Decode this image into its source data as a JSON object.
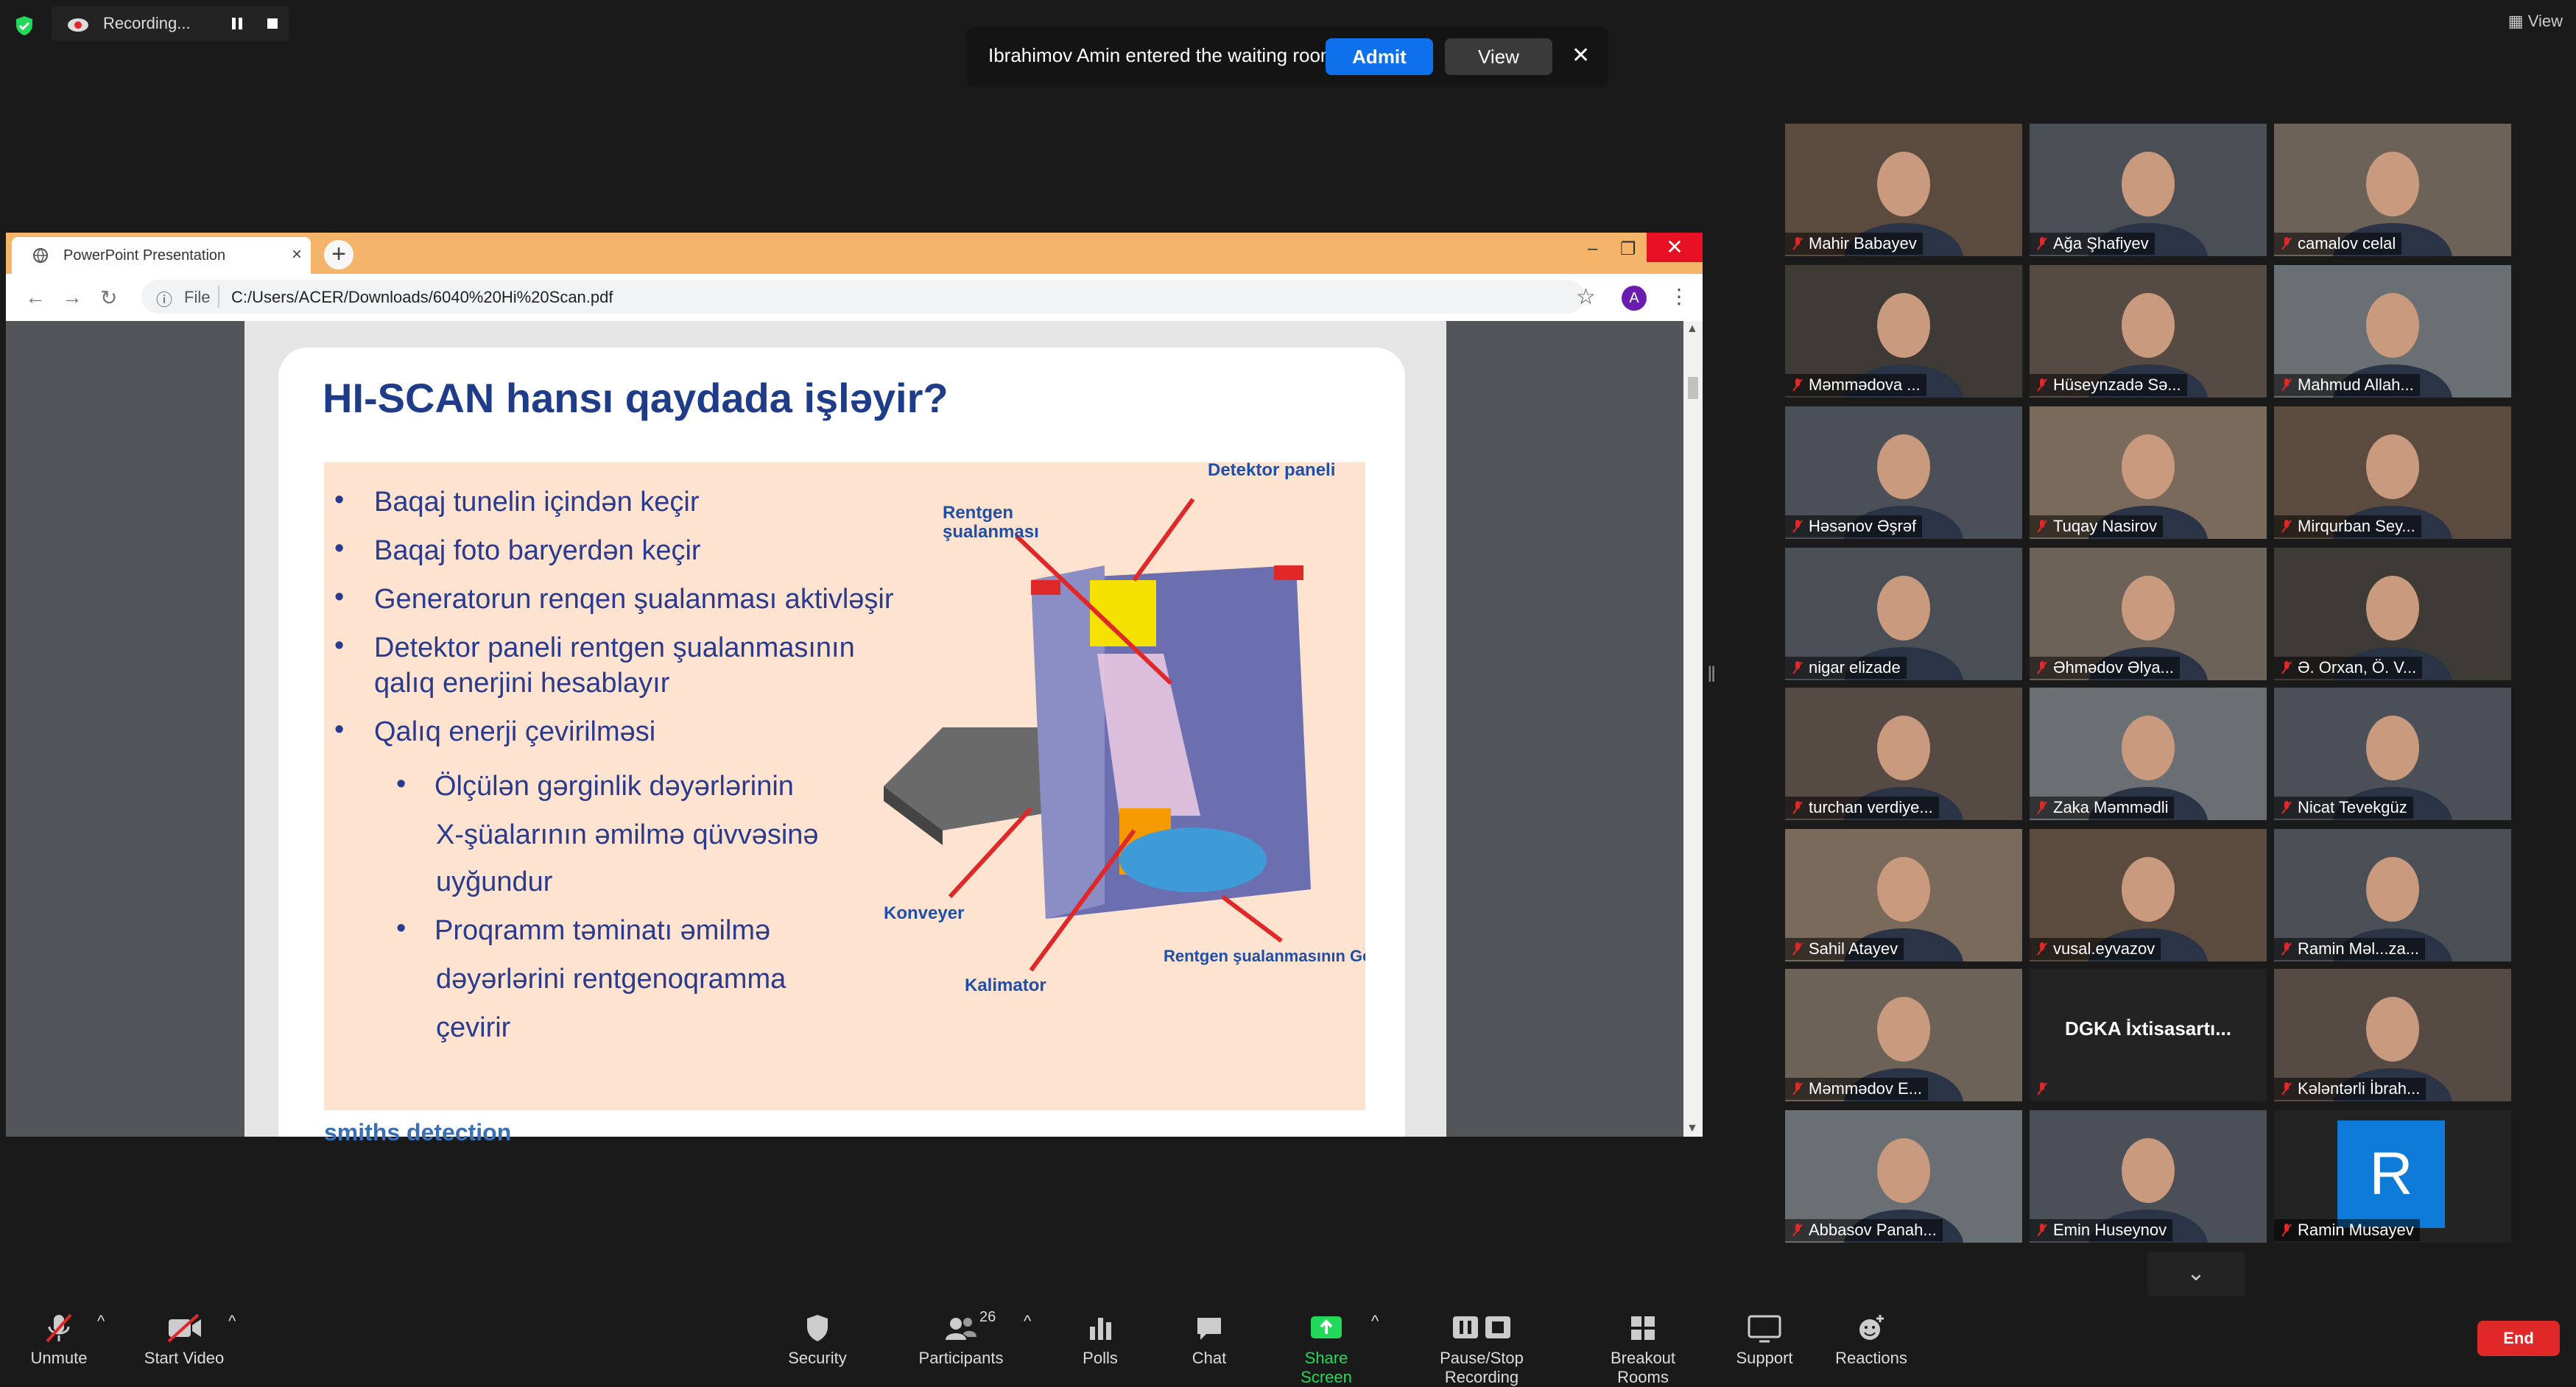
{
  "status": {
    "recording_label": "Recording...",
    "view_label": "View"
  },
  "notification": {
    "message": "Ibrahimov Amin entered the waiting room",
    "admit_label": "Admit",
    "view_label": "View"
  },
  "browser": {
    "tab_title": "PowerPoint Presentation",
    "url_scheme_label": "File",
    "url": "C:/Users/ACER/Downloads/6040%20Hi%20Scan.pdf",
    "profile_initial": "A"
  },
  "slide": {
    "title": "HI-SCAN hansı qaydada işləyir?",
    "bullets": [
      "Baqaj tunelin içindən keçir",
      "Baqaj foto baryerdən keçir",
      "Generatorun renqen şualanması aktivləşir",
      "Detektor paneli rentgen şualanmasının",
      "qalıq enerjini hesablayır",
      "Qalıq enerji çevirilməsi"
    ],
    "sub_bullets": [
      "Ölçülən gərginlik dəyərlərinin",
      "X-şüalarının əmilmə qüvvəsinə",
      "uyğundur",
      "Proqramm təminatı əmilmə",
      "dəyərlərini rentgenoqramma",
      "çevirir"
    ],
    "labels": {
      "detector": "Detektor paneli",
      "rentgen1": "Rentgen",
      "rentgen2": "şualanması",
      "conveyor": "Konveyer",
      "collimator": "Kalimator",
      "generator": "Rentgen şualanmasının Generatoru"
    },
    "footer": "smiths detection"
  },
  "participants": [
    {
      "name": "Mahir Babayev",
      "active": false
    },
    {
      "name": "Ağa Şhafiyev",
      "active": true
    },
    {
      "name": "camalov celal",
      "active": false
    },
    {
      "name": "Məmmədova ...",
      "active": false
    },
    {
      "name": "Hüseynzadə Sə...",
      "active": false
    },
    {
      "name": "Mahmud Allah...",
      "active": false
    },
    {
      "name": "Həsənov Əşrəf",
      "active": false
    },
    {
      "name": "Tuqay Nasirov",
      "active": false
    },
    {
      "name": "Mirqurban Sey...",
      "active": false
    },
    {
      "name": "nigar elizade",
      "active": false
    },
    {
      "name": "Əhmədov Əlya...",
      "active": false
    },
    {
      "name": "Ə. Orxan, Ö. V...",
      "active": false
    },
    {
      "name": "turchan verdiye...",
      "active": false
    },
    {
      "name": "Zaka Məmmədli",
      "active": false
    },
    {
      "name": "Nicat Tevekgüz",
      "active": false
    },
    {
      "name": "Sahil Atayev",
      "active": false
    },
    {
      "name": "vusal.eyvazov",
      "active": false
    },
    {
      "name": "Ramin Məl...za...",
      "active": false
    },
    {
      "name": "Məmmədov E...",
      "active": false
    },
    {
      "name": "",
      "active": false,
      "display_text": "DGKA İxtisasartı..."
    },
    {
      "name": "Kələntərli İbrah...",
      "active": false
    },
    {
      "name": "Abbasov Panah...",
      "active": false
    },
    {
      "name": "Emin Huseynov",
      "active": false
    },
    {
      "name": "Ramin Musayev",
      "active": false,
      "avatar_letter": "R"
    }
  ],
  "toolbar": {
    "unmute": "Unmute",
    "start_video": "Start Video",
    "security": "Security",
    "participants": "Participants",
    "participants_count": "26",
    "polls": "Polls",
    "chat": "Chat",
    "share_screen": "Share Screen",
    "pause_recording": "Pause/Stop Recording",
    "breakout_rooms": "Breakout Rooms",
    "support": "Support",
    "reactions": "Reactions",
    "end": "End"
  },
  "colors": {
    "accent_blue": "#0e71eb",
    "end_red": "#e02828",
    "share_green": "#23d959",
    "active_speaker": "#9bd82d",
    "tabbar_orange": "#f4b56a",
    "slide_title_blue": "#1f3c88"
  }
}
